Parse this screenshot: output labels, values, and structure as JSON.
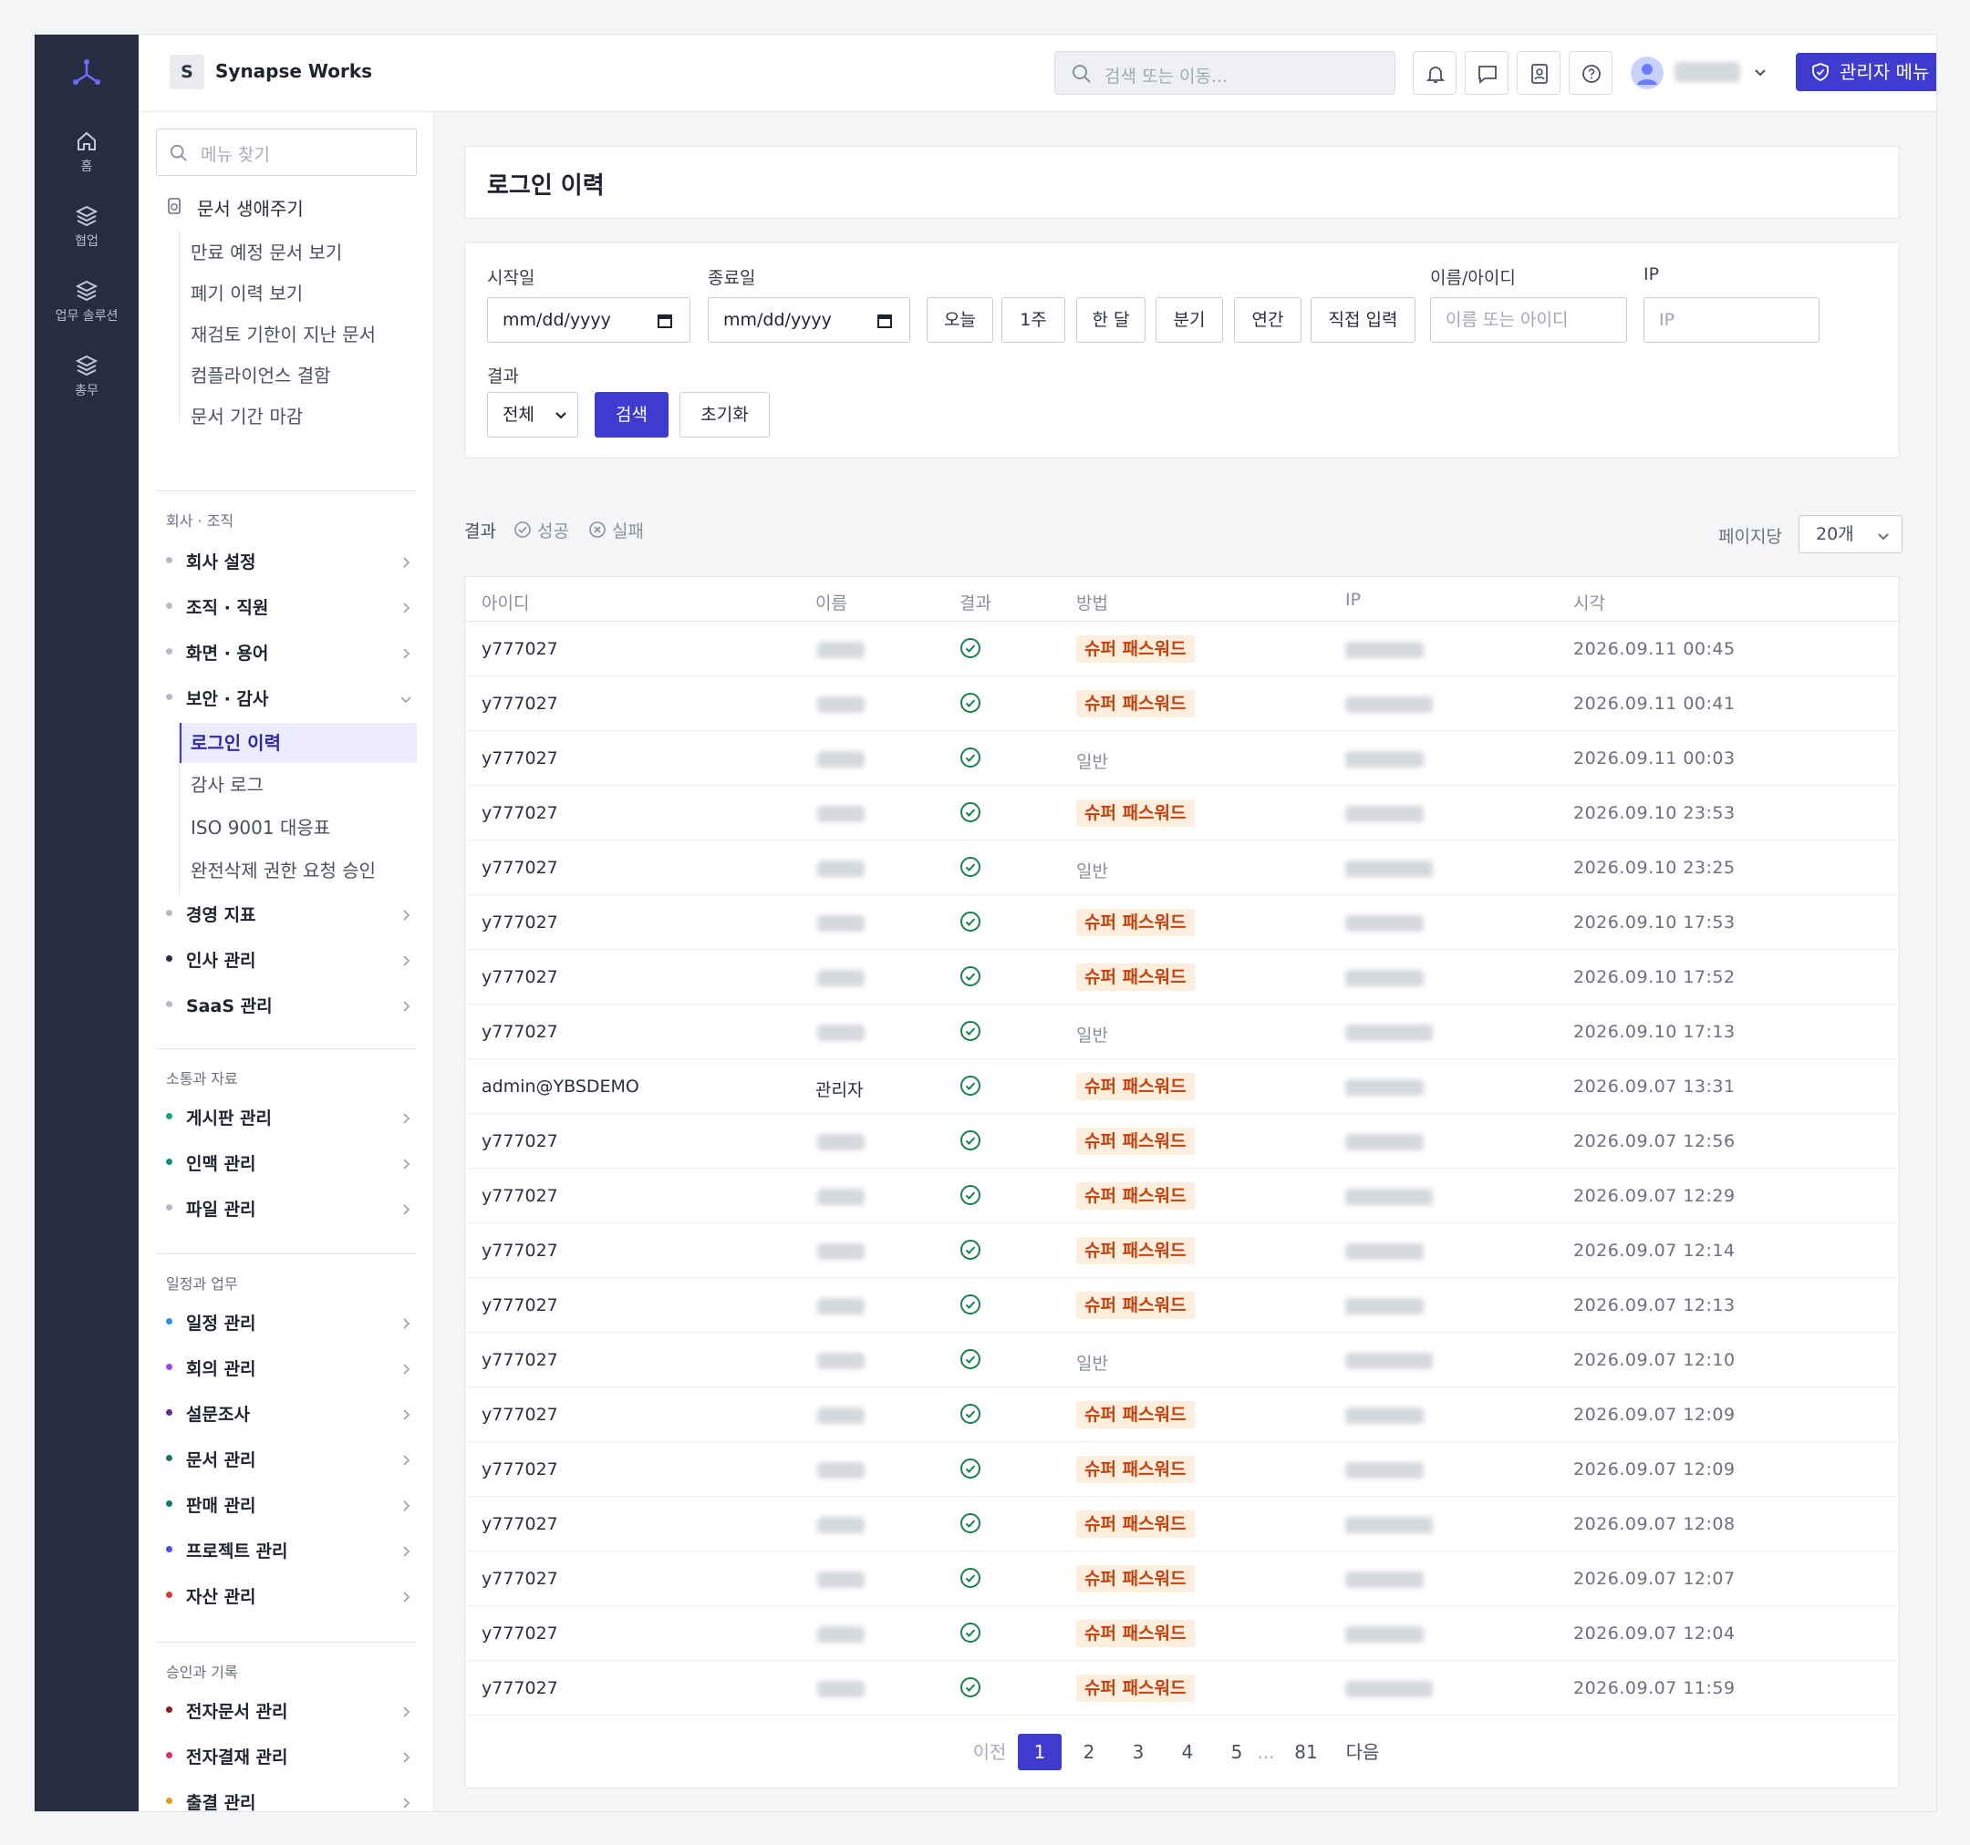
{
  "rail": {
    "items": [
      {
        "label": "홈",
        "icon": "home-icon"
      },
      {
        "label": "협업",
        "icon": "layers-icon"
      },
      {
        "label": "업무 솔루션",
        "icon": "layers-icon"
      },
      {
        "label": "총무",
        "icon": "layers-icon"
      }
    ]
  },
  "topbar": {
    "org_initial": "S",
    "org_name": "Synapse Works",
    "search_placeholder": "검색 또는 이동...",
    "admin_label": "관리자 메뉴"
  },
  "sidebar": {
    "search_placeholder": "메뉴 찾기",
    "doc_lifecycle": "문서 생애주기",
    "doc_sub": [
      "만료 예정 문서 보기",
      "폐기 이력 보기",
      "재검토 기한이 지난 문서",
      "컴플라이언스 결함",
      "문서 기간 마감"
    ],
    "sections": [
      {
        "title": "회사 · 조직",
        "items": [
          {
            "label": "회사 설정",
            "dot": "#b6bac4"
          },
          {
            "label": "조직 · 직원",
            "dot": "#b6bac4"
          },
          {
            "label": "화면 · 용어",
            "dot": "#b6bac4"
          },
          {
            "label": "보안 · 감사",
            "dot": "#b6bac4"
          }
        ]
      },
      {
        "title": "소통과 자료",
        "items": [
          {
            "label": "게시판 관리",
            "dot": "#22a06b"
          },
          {
            "label": "인맥 관리",
            "dot": "#0f8f7a"
          },
          {
            "label": "파일 관리",
            "dot": "#b6bac4"
          }
        ]
      },
      {
        "title": "일정과 업무",
        "items": [
          {
            "label": "일정 관리",
            "dot": "#2f8fd8"
          },
          {
            "label": "회의 관리",
            "dot": "#9a4ad8"
          },
          {
            "label": "설문조사",
            "dot": "#6b2d8f"
          },
          {
            "label": "문서 관리",
            "dot": "#1f7a4f"
          },
          {
            "label": "판매 관리",
            "dot": "#0f7a6a"
          },
          {
            "label": "프로젝트 관리",
            "dot": "#4f4fd8"
          },
          {
            "label": "자산 관리",
            "dot": "#d8353a"
          }
        ]
      },
      {
        "title": "승인과 기록",
        "items": [
          {
            "label": "전자문서 관리",
            "dot": "#8f2020"
          },
          {
            "label": "전자결재 관리",
            "dot": "#d8306a"
          },
          {
            "label": "출결 관리",
            "dot": "#e09a20"
          }
        ]
      }
    ],
    "security_sub": [
      "로그인 이력",
      "감사 로그",
      "ISO 9001 대응표",
      "완전삭제 권한 요청 승인"
    ],
    "more_items": [
      {
        "label": "경영 지표",
        "dot": "#b6bac4"
      },
      {
        "label": "인사 관리",
        "dot": "#2a2f3d"
      },
      {
        "label": "SaaS 관리",
        "dot": "#b6bac4"
      }
    ]
  },
  "page": {
    "title": "로그인 이력",
    "filters": {
      "start_label": "시작일",
      "start_value": "mm/dd/yyyy",
      "end_label": "종료일",
      "end_value": "mm/dd/yyyy",
      "ranges": [
        "오늘",
        "1주",
        "한 달",
        "분기",
        "연간",
        "직접 입력"
      ],
      "name_label": "이름/아이디",
      "name_placeholder": "이름 또는 아이디",
      "ip_label": "IP",
      "ip_placeholder": "IP",
      "result_label": "결과",
      "result_value": "전체",
      "search_btn": "검색",
      "reset_btn": "초기화"
    },
    "legend": {
      "label": "결과",
      "success": "성공",
      "fail": "실패"
    },
    "per_page_label": "페이지당",
    "per_page_value": "20개",
    "columns": [
      "아이디",
      "이름",
      "결과",
      "방법",
      "IP",
      "시각"
    ],
    "rows": [
      {
        "id": "y777027",
        "name": "",
        "method": "슈퍼 패스워드",
        "super": true,
        "time": "2026.09.11 00:45"
      },
      {
        "id": "y777027",
        "name": "",
        "method": "슈퍼 패스워드",
        "super": true,
        "time": "2026.09.11 00:41"
      },
      {
        "id": "y777027",
        "name": "",
        "method": "일반",
        "super": false,
        "time": "2026.09.11 00:03"
      },
      {
        "id": "y777027",
        "name": "",
        "method": "슈퍼 패스워드",
        "super": true,
        "time": "2026.09.10 23:53"
      },
      {
        "id": "y777027",
        "name": "",
        "method": "일반",
        "super": false,
        "time": "2026.09.10 23:25"
      },
      {
        "id": "y777027",
        "name": "",
        "method": "슈퍼 패스워드",
        "super": true,
        "time": "2026.09.10 17:53"
      },
      {
        "id": "y777027",
        "name": "",
        "method": "슈퍼 패스워드",
        "super": true,
        "time": "2026.09.10 17:52"
      },
      {
        "id": "y777027",
        "name": "",
        "method": "일반",
        "super": false,
        "time": "2026.09.10 17:13"
      },
      {
        "id": "admin@YBSDEMO",
        "name": "관리자",
        "method": "슈퍼 패스워드",
        "super": true,
        "time": "2026.09.07 13:31"
      },
      {
        "id": "y777027",
        "name": "",
        "method": "슈퍼 패스워드",
        "super": true,
        "time": "2026.09.07 12:56"
      },
      {
        "id": "y777027",
        "name": "",
        "method": "슈퍼 패스워드",
        "super": true,
        "time": "2026.09.07 12:29"
      },
      {
        "id": "y777027",
        "name": "",
        "method": "슈퍼 패스워드",
        "super": true,
        "time": "2026.09.07 12:14"
      },
      {
        "id": "y777027",
        "name": "",
        "method": "슈퍼 패스워드",
        "super": true,
        "time": "2026.09.07 12:13"
      },
      {
        "id": "y777027",
        "name": "",
        "method": "일반",
        "super": false,
        "time": "2026.09.07 12:10"
      },
      {
        "id": "y777027",
        "name": "",
        "method": "슈퍼 패스워드",
        "super": true,
        "time": "2026.09.07 12:09"
      },
      {
        "id": "y777027",
        "name": "",
        "method": "슈퍼 패스워드",
        "super": true,
        "time": "2026.09.07 12:09"
      },
      {
        "id": "y777027",
        "name": "",
        "method": "슈퍼 패스워드",
        "super": true,
        "time": "2026.09.07 12:08"
      },
      {
        "id": "y777027",
        "name": "",
        "method": "슈퍼 패스워드",
        "super": true,
        "time": "2026.09.07 12:07"
      },
      {
        "id": "y777027",
        "name": "",
        "method": "슈퍼 패스워드",
        "super": true,
        "time": "2026.09.07 12:04"
      },
      {
        "id": "y777027",
        "name": "",
        "method": "슈퍼 패스워드",
        "super": true,
        "time": "2026.09.07 11:59"
      }
    ],
    "pagination": {
      "prev": "이전",
      "pages": [
        "1",
        "2",
        "3",
        "4",
        "5"
      ],
      "ellipsis": "...",
      "last": "81",
      "next": "다음",
      "current": "1"
    }
  },
  "colors": {
    "accent": "#3f3bd0",
    "success": "#1a7f4b",
    "tag_bg": "#fdeedd",
    "tag_fg": "#c2410c"
  }
}
